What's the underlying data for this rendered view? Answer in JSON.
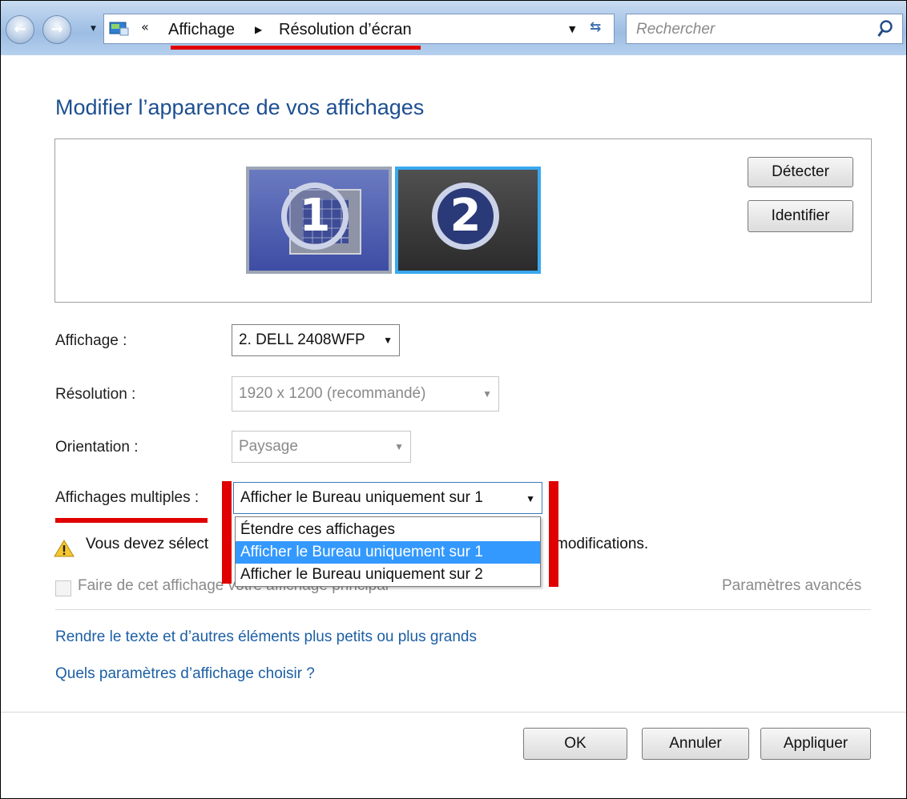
{
  "navigation": {
    "breadcrumb_chevron": "«",
    "crumb_1": "Affichage",
    "crumb_arrow": "▶",
    "crumb_2": "Résolution d’écran",
    "search_placeholder": "Rechercher"
  },
  "page": {
    "heading": "Modifier l’apparence de vos affichages"
  },
  "preview": {
    "monitor_1_number": "1",
    "monitor_2_number": "2",
    "detect_label": "Détecter",
    "identify_label": "Identifier"
  },
  "settings": {
    "display_label": "Affichage :",
    "display_value": "2. DELL 2408WFP",
    "resolution_label": "Résolution :",
    "resolution_value": "1920 x 1200 (recommandé)",
    "orientation_label": "Orientation :",
    "orientation_value": "Paysage",
    "multiple_label": "Affichages multiples :",
    "multiple_value": "Afficher le Bureau uniquement sur 1",
    "multiple_options": [
      "Étendre ces affichages",
      "Afficher le Bureau uniquement sur 1",
      "Afficher le Bureau uniquement sur 2"
    ],
    "multiple_selected_index": 1,
    "warning_text_visible_left": "Vous devez sélect",
    "warning_text_visible_right": "modifications.",
    "primary_checkbox_label_visible": "Faire de cet affichage votre affichage principal",
    "advanced_link": "Paramètres avancés"
  },
  "links": {
    "text_size": "Rendre le texte et d’autres éléments plus petits ou plus grands",
    "which_settings": "Quels paramètres d’affichage choisir ?"
  },
  "footer": {
    "ok_label": "OK",
    "cancel_label": "Annuler",
    "apply_label": "Appliquer"
  },
  "colors": {
    "heading_blue": "#1d4f91",
    "link_blue": "#1c5fa5",
    "selection_blue": "#3399ff",
    "annotation_red": "#e00000"
  }
}
